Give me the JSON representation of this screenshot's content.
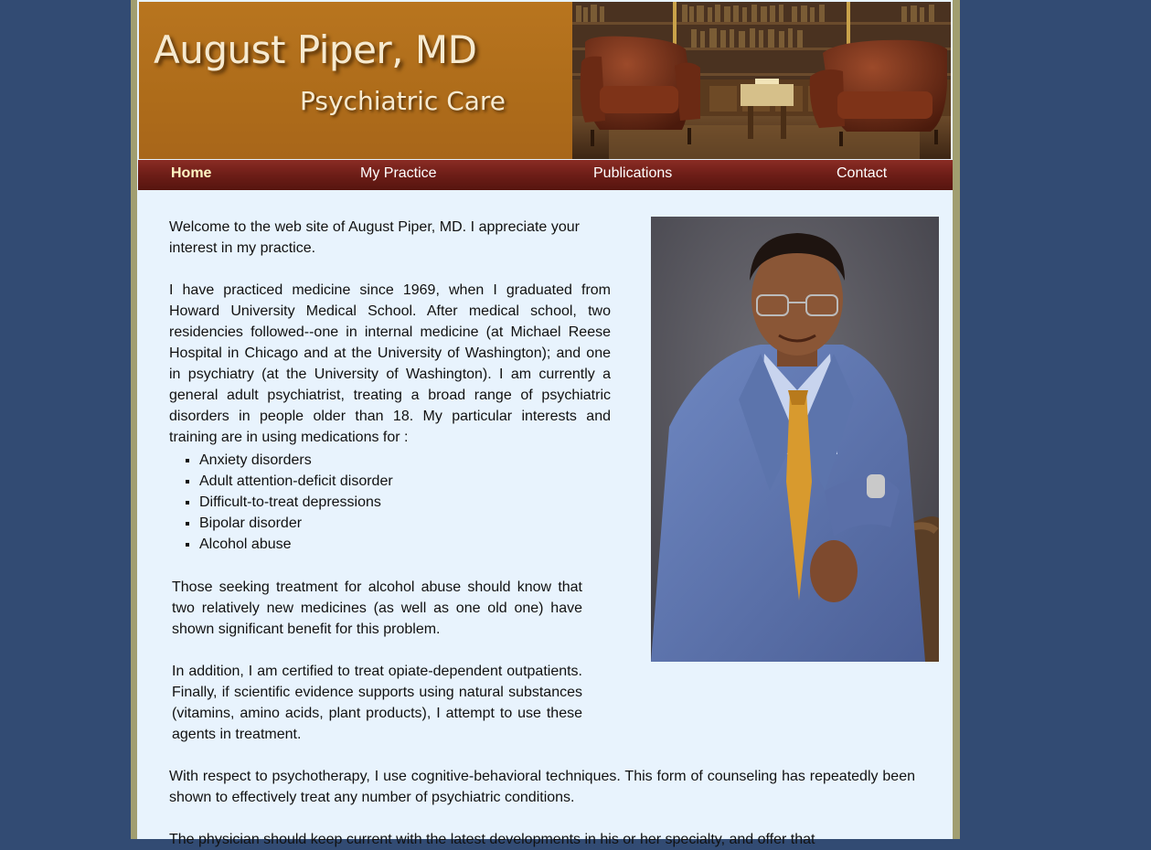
{
  "header": {
    "name": "August Piper, MD",
    "subtitle": "Psychiatric Care"
  },
  "nav": {
    "items": [
      {
        "label": "Home",
        "active": true
      },
      {
        "label": "My Practice",
        "active": false
      },
      {
        "label": "Publications",
        "active": false
      },
      {
        "label": "Contact",
        "active": false
      }
    ]
  },
  "content": {
    "welcome": "Welcome to the web site of August Piper, MD. I appreciate your interest in my practice.",
    "practice": "I have practiced medicine since 1969, when I graduated from Howard University Medical School. After medical school, two residencies followed--one in internal medicine (at Michael Reese Hospital in Chicago and at the University of Washington); and one in psychiatry (at the University of Washington). I am currently a general adult psychiatrist, treating a broad range of psychiatric disorders in people older than 18. My particular interests and training are in using medications for :",
    "interests": [
      "Anxiety disorders",
      "Adult attention-deficit disorder",
      "Difficult-to-treat depressions",
      "Bipolar disorder",
      "Alcohol abuse"
    ],
    "alcohol": "Those seeking treatment for alcohol abuse should know that two relatively new medicines (as well as one old one) have shown significant benefit for this problem.",
    "opiate": "In addition, I am certified to treat opiate-dependent outpatients. Finally, if scientific evidence supports using natural substances (vitamins, amino acids, plant products), I attempt to use these agents in treatment.",
    "psychotherapy": "With respect to psychotherapy, I use cognitive-behavioral techniques. This form of counseling has repeatedly been shown to effectively treat any number of psychiatric conditions.",
    "physician": "The physician should keep current with the latest developments in his or her specialty, and offer that"
  }
}
